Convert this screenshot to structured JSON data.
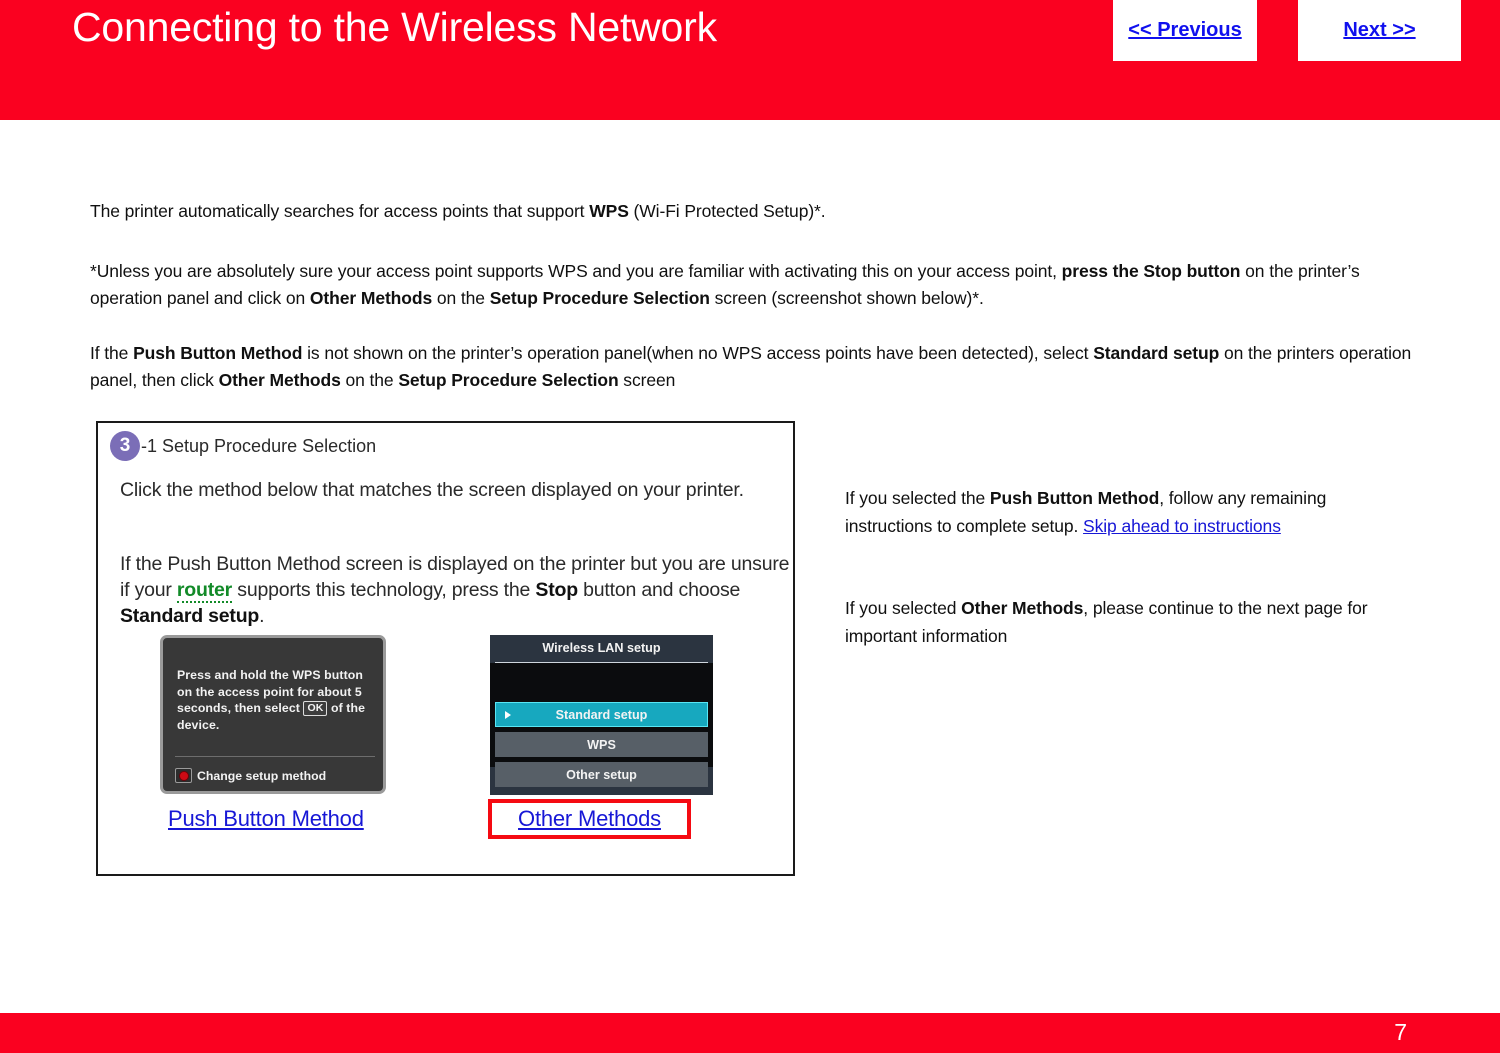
{
  "header": {
    "title": "Connecting to the Wireless Network",
    "prev_label": "<< Previous",
    "next_label": "Next >>",
    "background_color": "#FA0120",
    "link_color": "#1010EE"
  },
  "body": {
    "paragraph1": {
      "seg1": "The  printer automatically searches for access points that support ",
      "bold1": "WPS",
      "seg2": " (Wi-Fi Protected Setup)*."
    },
    "paragraph2": {
      "seg1": "*Unless you are absolutely sure your access point supports WPS and you are familiar with activating  this on your access point, ",
      "bold1": "press the Stop button",
      "seg2": " on the printer’s operation panel and click on  ",
      "bold2": "Other Methods",
      "seg3": " on the ",
      "bold3": "Setup Procedure Selection",
      "seg4": " screen (screenshot shown below)*."
    },
    "paragraph3": {
      "seg1": "If the ",
      "bold1": "Push Button Method",
      "seg2": " is not shown  on the printer’s operation panel(when no WPS access points have been detected), select ",
      "bold2": "Standard setup",
      "seg3": " on the printers operation panel, then click ",
      "bold3": "Other Methods",
      "seg4": " on the ",
      "bold4": "Setup Procedure Selection",
      "seg5": " screen"
    }
  },
  "figure": {
    "badge_number": "3",
    "badge_color": "#7B6EB7",
    "heading_suffix": "-1 Setup Procedure Selection",
    "paragraph_a": "Click the method below that matches the screen displayed on your printer.",
    "paragraph_b": {
      "seg1": "If the Push Button Method screen is displayed on the printer but you are unsure if your ",
      "link_word": "router",
      "link_color": "#128A28",
      "seg2": " supports this technology, press the ",
      "bold1": "Stop",
      "seg3": " button and choose ",
      "bold2": "Standard setup",
      "seg4": "."
    },
    "lcd_left": {
      "text_seg1": "Press and hold the WPS button on the access point for about 5 seconds, then select ",
      "ok_key": "OK",
      "text_seg2": " of the device.",
      "footer_label": "Change setup method",
      "background_color": "#383838"
    },
    "lcd_right": {
      "title": "Wireless LAN setup",
      "items": [
        {
          "label": "Standard setup",
          "selected": true
        },
        {
          "label": "WPS",
          "selected": false
        },
        {
          "label": "Other setup",
          "selected": false
        }
      ],
      "selected_color": "#17A8BF",
      "background_color": "#2b3440"
    },
    "caption_left": "Push Button Method",
    "caption_right": "Other Methods",
    "caption_right_highlight_color": "#F50A12"
  },
  "notes": {
    "note1": {
      "seg1": "If you selected the ",
      "bold1": "Push Button Method",
      "seg2": ", follow any remaining instructions to complete setup. ",
      "link": "Skip ahead to instructions"
    },
    "note2": {
      "seg1": "If you selected ",
      "bold1": "Other Methods",
      "seg2": ", please continue to the next page  for important information"
    }
  },
  "footer": {
    "page_number": "7",
    "background_color": "#FA0120"
  }
}
